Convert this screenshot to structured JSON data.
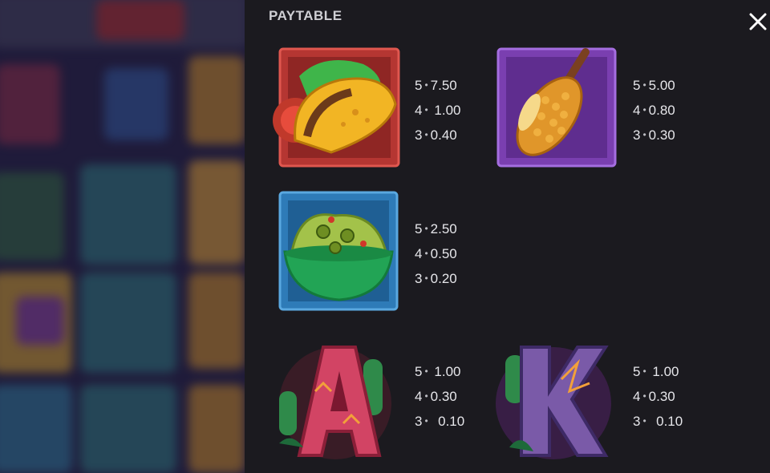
{
  "title": "PAYTABLE",
  "close": {
    "icon": "close-icon"
  },
  "symbols": [
    {
      "name": "taco",
      "icon": "taco-icon",
      "pays": [
        {
          "count": "5",
          "value": "7.50"
        },
        {
          "count": "4",
          "value": "1.00"
        },
        {
          "count": "3",
          "value": "0.40"
        }
      ]
    },
    {
      "name": "corn",
      "icon": "corn-icon",
      "pays": [
        {
          "count": "5",
          "value": "5.00"
        },
        {
          "count": "4",
          "value": "0.80"
        },
        {
          "count": "3",
          "value": "0.30"
        }
      ]
    },
    {
      "name": "guacamole",
      "icon": "guacamole-icon",
      "pays": [
        {
          "count": "5",
          "value": "2.50"
        },
        {
          "count": "4",
          "value": "0.50"
        },
        {
          "count": "3",
          "value": "0.20"
        }
      ]
    },
    {
      "name": "letter-a",
      "icon": "letter-a-icon",
      "pays": [
        {
          "count": "5",
          "value": "1.00"
        },
        {
          "count": "4",
          "value": "0.30"
        },
        {
          "count": "3",
          "value": "0.10"
        }
      ]
    },
    {
      "name": "letter-k",
      "icon": "letter-k-icon",
      "pays": [
        {
          "count": "5",
          "value": "1.00"
        },
        {
          "count": "4",
          "value": "0.30"
        },
        {
          "count": "3",
          "value": "0.10"
        }
      ]
    }
  ],
  "colors": {
    "panel_bg": "#1b1a1f",
    "text": "#e6e6ea",
    "title": "#cfcfd4"
  }
}
